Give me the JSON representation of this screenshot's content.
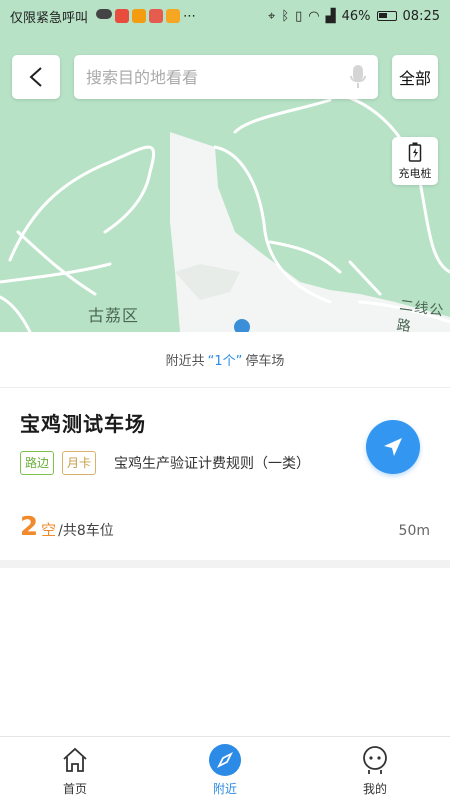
{
  "status_bar": {
    "left_text": "仅限紧急呼叫",
    "battery": "46%",
    "time": "08:25"
  },
  "search": {
    "placeholder": "搜索目的地看看",
    "all_label": "全部"
  },
  "map": {
    "charge_label": "充电桩",
    "district_label": "古荔区",
    "road_label": "二线公路"
  },
  "nearby": {
    "prefix": "附近共",
    "count": "“1个”",
    "suffix": "停车场"
  },
  "lot": {
    "name": "宝鸡测试车场",
    "tags": [
      "路边",
      "月卡"
    ],
    "rule": "宝鸡生产验证计费规则（一类）",
    "free_spaces": "2",
    "free_label": "空",
    "total_label": "/共8车位",
    "distance": "50m"
  },
  "bottom_nav": {
    "items": [
      {
        "label": "首页",
        "icon": "home-icon"
      },
      {
        "label": "附近",
        "icon": "compass-icon"
      },
      {
        "label": "我的",
        "icon": "user-face-icon"
      }
    ],
    "active_index": 1
  },
  "colors": {
    "accent_blue": "#2b8be6",
    "map_green": "#b7e2c6",
    "orange": "#f08a2c",
    "tag_green": "#6db13c",
    "tag_gold": "#c79b45"
  }
}
